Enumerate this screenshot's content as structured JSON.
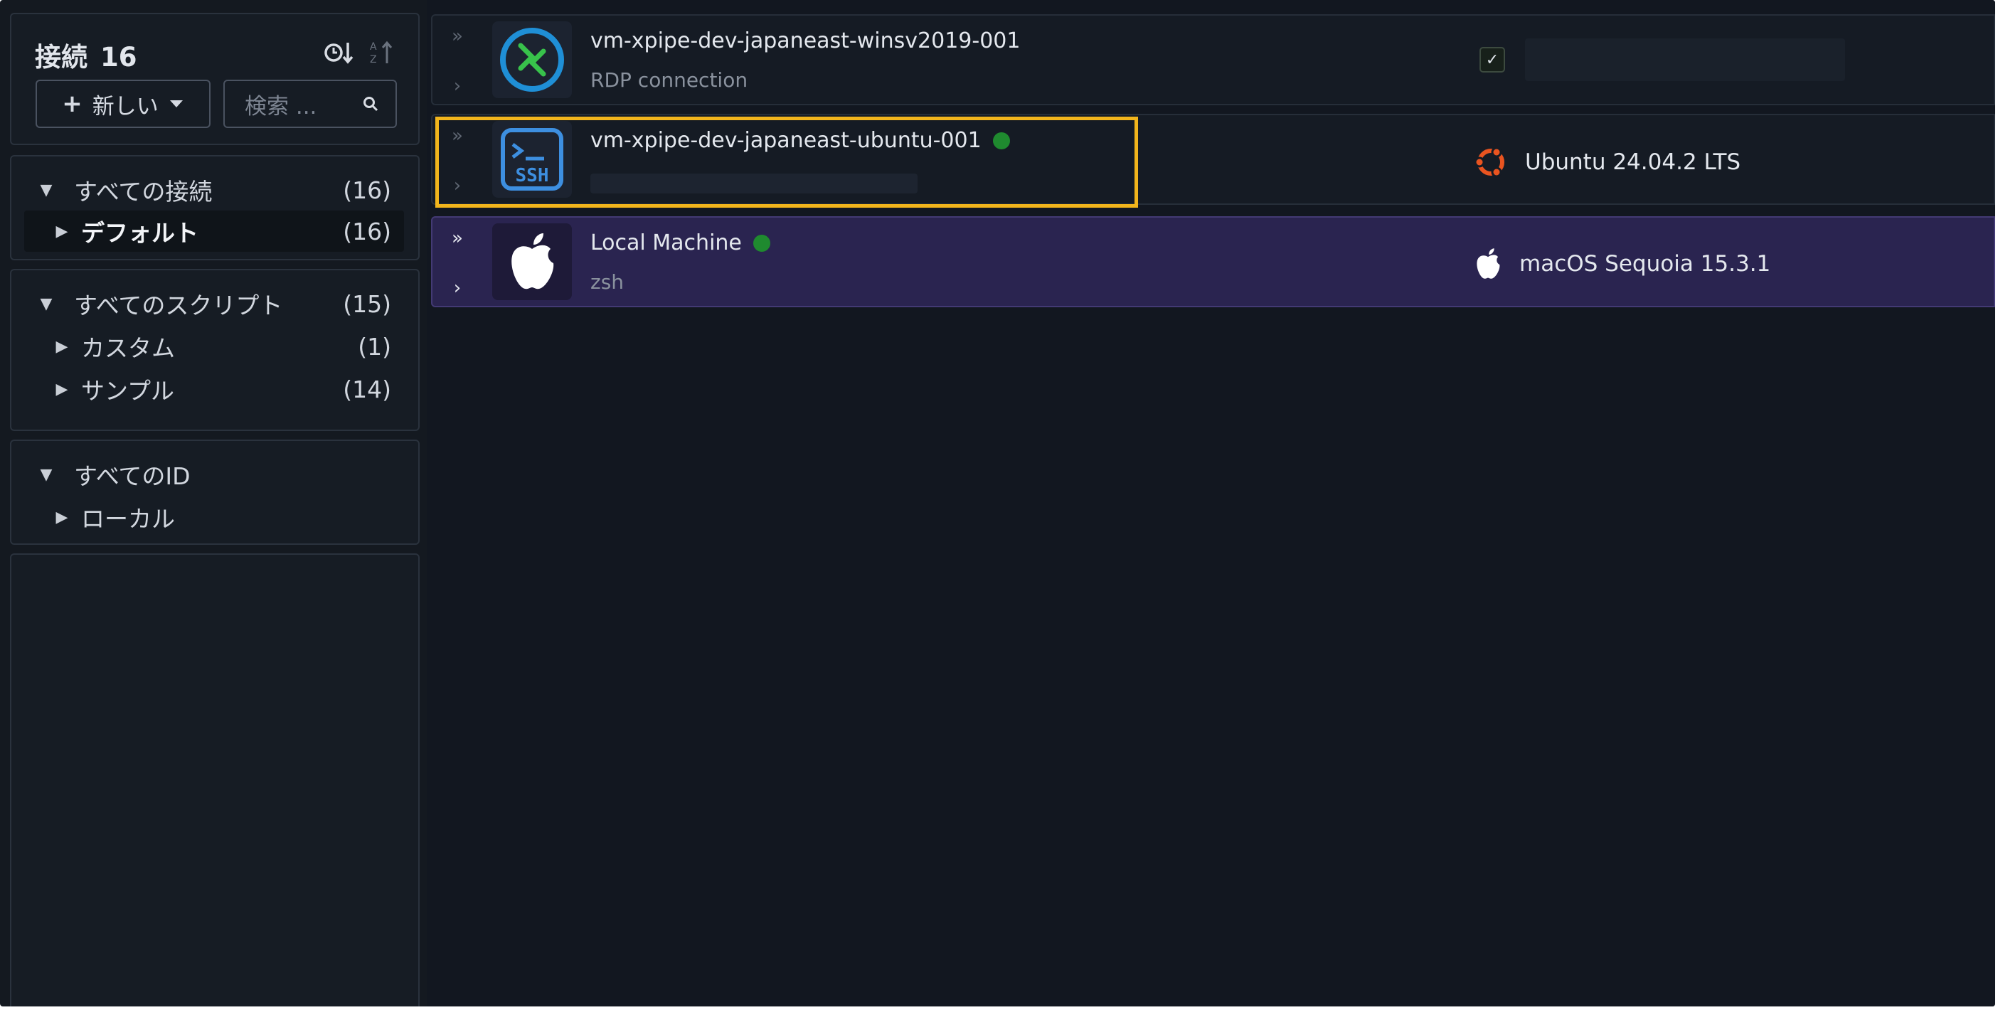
{
  "sidebar": {
    "title": "接続",
    "count": "16",
    "new_button_label": "新しい",
    "search_placeholder": "検索 ...",
    "connections": {
      "root": {
        "label": "すべての接続",
        "count": "(16)"
      },
      "children": [
        {
          "label": "デフォルト",
          "count": "(16)"
        }
      ]
    },
    "scripts": {
      "root": {
        "label": "すべてのスクリプト",
        "count": "(15)"
      },
      "children": [
        {
          "label": "カスタム",
          "count": "(1)"
        },
        {
          "label": "サンプル",
          "count": "(14)"
        }
      ]
    },
    "identities": {
      "root": {
        "label": "すべてのID"
      },
      "children": [
        {
          "label": "ローカル"
        }
      ]
    }
  },
  "connections": [
    {
      "name": "vm-xpipe-dev-japaneast-winsv2019-001",
      "subtitle": "RDP connection",
      "icon": "rdp-icon",
      "status": null,
      "os": null
    },
    {
      "name": "vm-xpipe-dev-japaneast-ubuntu-001",
      "subtitle": null,
      "icon": "ssh-icon",
      "status": "online",
      "os": {
        "label": "Ubuntu 24.04.2 LTS",
        "icon": "ubuntu-icon"
      }
    },
    {
      "name": "Local Machine",
      "subtitle": "zsh",
      "icon": "apple-icon",
      "status": "online",
      "os": {
        "label": "macOS Sequoia 15.3.1",
        "icon": "apple-icon"
      }
    }
  ],
  "colors": {
    "status_online": "#1f8a2f",
    "focus_outline": "#f2b51c",
    "selected_row": "#2a2450",
    "ubuntu": "#e95420",
    "rdp_ring": "#1f8fd6",
    "rdp_arrow": "#38c24b",
    "ssh": "#3d8fe0"
  }
}
